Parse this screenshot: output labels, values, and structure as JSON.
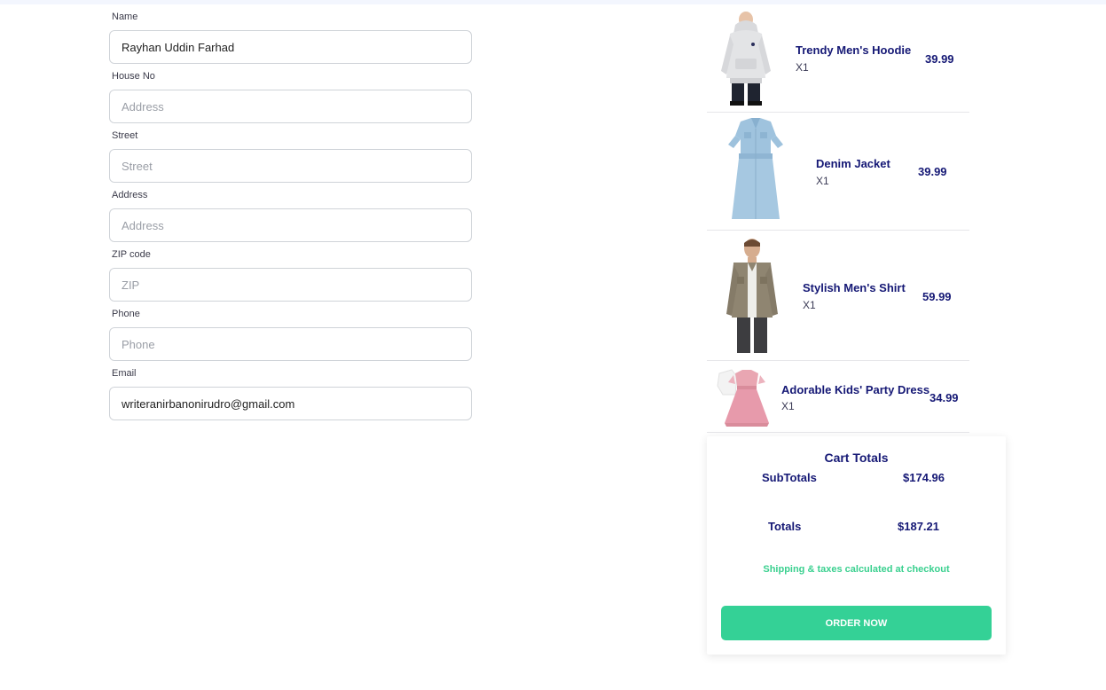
{
  "form": {
    "fields": [
      {
        "label": "Name",
        "value": "Rayhan Uddin Farhad",
        "placeholder": ""
      },
      {
        "label": "House No",
        "value": "",
        "placeholder": "Address"
      },
      {
        "label": "Street",
        "value": "",
        "placeholder": "Street"
      },
      {
        "label": "Address",
        "value": "",
        "placeholder": "Address"
      },
      {
        "label": "ZIP code",
        "value": "",
        "placeholder": "ZIP"
      },
      {
        "label": "Phone",
        "value": "",
        "placeholder": "Phone"
      },
      {
        "label": "Email",
        "value": "writeranirbanonirudro@gmail.com",
        "placeholder": ""
      }
    ]
  },
  "cart": {
    "items": [
      {
        "name": "Trendy Men's Hoodie",
        "qty": "X1",
        "price": "39.99",
        "image_icon": "hoodie-image"
      },
      {
        "name": "Denim Jacket",
        "qty": "X1",
        "price": "39.99",
        "image_icon": "denim-dress-image"
      },
      {
        "name": "Stylish Men's Shirt",
        "qty": "X1",
        "price": "59.99",
        "image_icon": "shirt-jacket-image"
      },
      {
        "name": "Adorable Kids' Party Dress",
        "qty": "X1",
        "price": "34.99",
        "image_icon": "kids-dress-image"
      }
    ]
  },
  "totals": {
    "title": "Cart Totals",
    "subtotal_label": "SubTotals",
    "subtotal_value": "$174.96",
    "total_label": "Totals",
    "total_value": "$187.21",
    "shipping_note": "Shipping & taxes calculated at checkout",
    "order_button": "ORDER NOW"
  },
  "colors": {
    "heading": "#151875",
    "accent": "#34d196",
    "shipping_text": "#3ad08f"
  }
}
